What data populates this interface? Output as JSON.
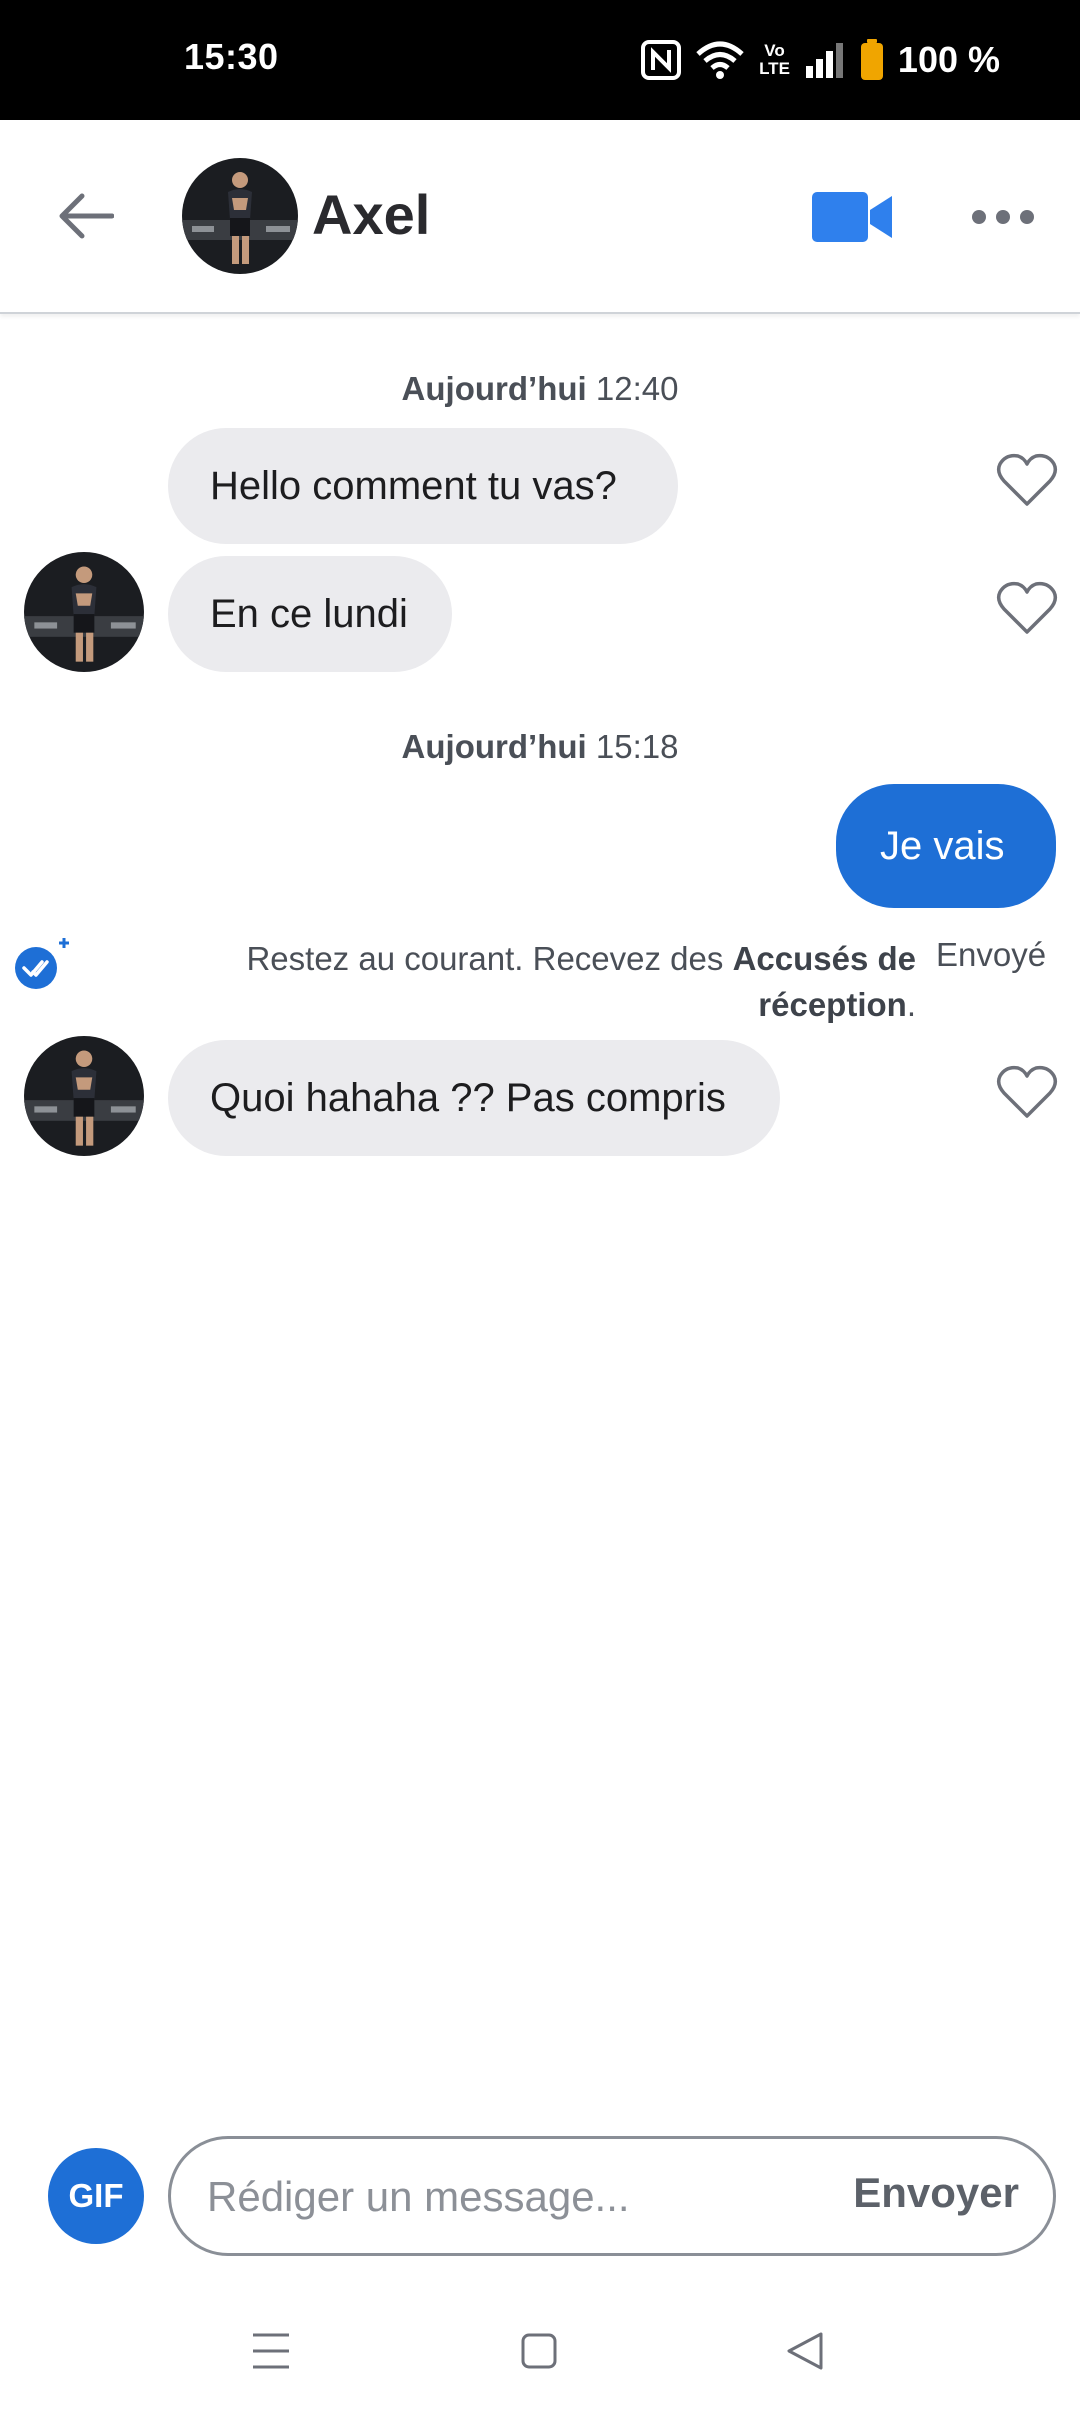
{
  "status_bar": {
    "time": "15:30",
    "battery": "100 %",
    "icons": [
      "nfc-icon",
      "wifi-icon",
      "volte-icon",
      "signal-icon",
      "battery-icon"
    ],
    "volte_label_top": "Vo",
    "volte_label_bottom": "LTE"
  },
  "header": {
    "contact_name": "Axel",
    "icons": [
      "back-arrow-icon",
      "video-call-icon",
      "more-options-icon"
    ]
  },
  "conversation": {
    "timestamps": [
      {
        "day": "Aujourd’hui",
        "time": "12:40"
      },
      {
        "day": "Aujourd’hui",
        "time": "15:18"
      }
    ],
    "messages": [
      {
        "sender": "Axel",
        "text": "Hello comment tu vas?"
      },
      {
        "sender": "Axel",
        "text": "En ce lundi"
      },
      {
        "sender": "me",
        "text": "Je vais"
      },
      {
        "sender": "Axel",
        "text": "Quoi hahaha ?? Pas compris"
      }
    ],
    "receipt": {
      "text_before": "Restez au courant. Recevez des ",
      "bold": "Accusés de réception",
      "text_after": ".",
      "status": "Envoyé"
    }
  },
  "composer": {
    "gif_label": "GIF",
    "placeholder": "Rédiger un message...",
    "send_label": "Envoyer"
  },
  "nav": {
    "icons": [
      "recents-icon",
      "home-icon",
      "back-icon"
    ]
  },
  "colors": {
    "accent": "#1e6fd6",
    "bubble_received": "#ebebee",
    "video_icon": "#2f80ed"
  }
}
